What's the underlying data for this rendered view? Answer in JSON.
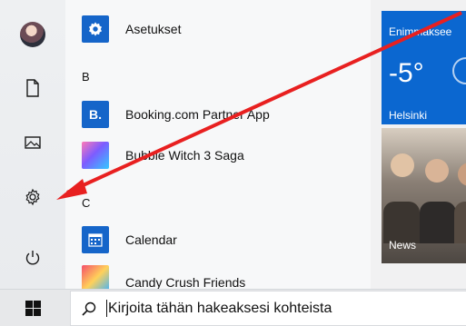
{
  "start_menu": {
    "groups": [
      {
        "letter": "B"
      },
      {
        "letter": "C"
      }
    ],
    "apps": [
      {
        "label": "Asetukset",
        "icon": "gear-icon"
      },
      {
        "label": "Booking.com Partner App",
        "icon": "booking-icon",
        "icon_text": "B."
      },
      {
        "label": "Bubble Witch 3 Saga",
        "icon": "bubble-witch-icon"
      },
      {
        "label": "Calendar",
        "icon": "calendar-icon"
      },
      {
        "label": "Candy Crush Friends",
        "icon": "candy-crush-icon"
      }
    ],
    "left_rail": [
      {
        "name": "user-avatar"
      },
      {
        "name": "documents-icon"
      },
      {
        "name": "pictures-icon"
      },
      {
        "name": "settings-icon"
      },
      {
        "name": "power-icon"
      }
    ]
  },
  "tiles": {
    "weather": {
      "header": "Enimmäksee",
      "temperature": "-5°",
      "city": "Helsinki"
    },
    "news": {
      "label": "News"
    }
  },
  "taskbar": {
    "search_placeholder": "Kirjoita tähän hakeaksesi kohteista"
  },
  "annotation": {
    "color": "#e82020"
  }
}
